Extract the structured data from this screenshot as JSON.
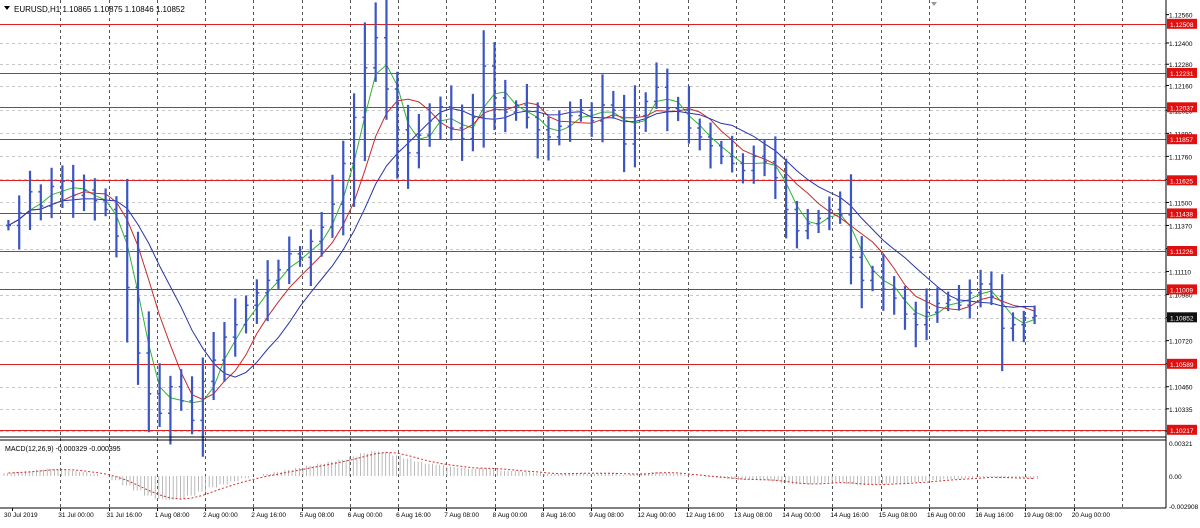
{
  "header": {
    "symbol_line": "EURUSD,H1  1.10865 1.10875 1.10846 1.10852",
    "macd_line": "MACD(12,26,9) -0.000329 -0.000395"
  },
  "colors": {
    "background": "#ffffff",
    "candles": "#3b55c4",
    "level_lines": "#e02020",
    "level_label_bg": "#e01010",
    "current_label_bg": "#111111",
    "ma_fast": "#32b332",
    "ma_mid": "#c62a2a",
    "ma_slow": "#2a33a8",
    "grid": "#000000",
    "macd_hist": "#a8a8a8",
    "macd_signal": "#d03030"
  },
  "chart_data": [
    {
      "type": "candlestick",
      "title": "EURUSD,H1",
      "ylim": [
        1.1021,
        1.1262
      ],
      "grid": true,
      "price_ticks": [
        "1.12560",
        "1.12400",
        "1.12280",
        "1.12160",
        "1.12020",
        "1.11890",
        "1.11760",
        "1.11630",
        "1.11500",
        "1.11370",
        "1.11240",
        "1.11110",
        "1.10980",
        "1.10850",
        "1.10720",
        "1.10590",
        "1.10460",
        "1.10335",
        "1.10210"
      ],
      "tick_values": [
        1.1256,
        1.124,
        1.1228,
        1.1216,
        1.1202,
        1.1189,
        1.1176,
        1.1163,
        1.115,
        1.1137,
        1.1124,
        1.1111,
        1.1098,
        1.1085,
        1.1072,
        1.1059,
        1.1046,
        1.10335,
        1.1021
      ],
      "levels": [
        {
          "label": "1.12508",
          "value": 1.12508
        },
        {
          "label": "1.12231",
          "value": 1.12231
        },
        {
          "label": "1.12037",
          "value": 1.12037
        },
        {
          "label": "1.11857",
          "value": 1.11857
        },
        {
          "label": "1.11625",
          "value": 1.11625
        },
        {
          "label": "1.11438",
          "value": 1.11438
        },
        {
          "label": "1.11226",
          "value": 1.11226
        },
        {
          "label": "1.11009",
          "value": 1.11009
        },
        {
          "label": "1.10589",
          "value": 1.10589
        },
        {
          "label": "1.10217",
          "value": 1.10217
        }
      ],
      "current_price": {
        "label": "1.10852",
        "value": 1.10852
      },
      "x_labels": [
        "30 Jul 2019",
        "31 Jul 00:00",
        "31 Jul 16:00",
        "1 Aug 08:00",
        "2 Aug 00:00",
        "2 Aug 16:00",
        "5 Aug 08:00",
        "6 Aug 00:00",
        "6 Aug 16:00",
        "7 Aug 08:00",
        "8 Aug 00:00",
        "8 Aug 16:00",
        "9 Aug 08:00",
        "12 Aug 00:00",
        "12 Aug 16:00",
        "13 Aug 08:00",
        "14 Aug 00:00",
        "14 Aug 16:00",
        "15 Aug 08:00",
        "16 Aug 00:00",
        "16 Aug 16:00",
        "19 Aug 08:00",
        "20 Aug 00:00"
      ],
      "closes": [
        1.1137,
        1.1144,
        1.1156,
        1.1148,
        1.1159,
        1.1162,
        1.1154,
        1.1157,
        1.1151,
        1.1146,
        1.1131,
        1.1102,
        1.1065,
        1.1042,
        1.1031,
        1.1046,
        1.1038,
        1.1027,
        1.1049,
        1.1061,
        1.1074,
        1.1081,
        1.1092,
        1.1099,
        1.1106,
        1.1112,
        1.1121,
        1.1119,
        1.1128,
        1.1136,
        1.1149,
        1.1172,
        1.1198,
        1.1226,
        1.1243,
        1.1214,
        1.1191,
        1.1178,
        1.1188,
        1.1196,
        1.1204,
        1.1192,
        1.1186,
        1.1198,
        1.1227,
        1.1209,
        1.1201,
        1.1205,
        1.1198,
        1.1191,
        1.1187,
        1.1193,
        1.1199,
        1.1202,
        1.1196,
        1.1205,
        1.1202,
        1.1183,
        1.1199,
        1.1207,
        1.1215,
        1.1203,
        1.1202,
        1.1192,
        1.1187,
        1.1182,
        1.1176,
        1.1172,
        1.1168,
        1.1176,
        1.1173,
        1.1164,
        1.1146,
        1.1134,
        1.1138,
        1.1141,
        1.1146,
        1.1143,
        1.1119,
        1.1106,
        1.1111,
        1.1101,
        1.1096,
        1.1087,
        1.1081,
        1.1088,
        1.1093,
        1.1095,
        1.1092,
        1.1099,
        1.1104,
        1.1097,
        1.1079,
        1.1081,
        1.1085,
        1.1086
      ]
    },
    {
      "type": "macd",
      "title": "MACD(12,26,9)",
      "ylim": [
        -0.002908,
        0.00321
      ],
      "ticks": [
        "0.00321",
        "0.00",
        "-0.002908"
      ],
      "tick_values": [
        0.00321,
        0,
        -0.002908
      ],
      "histogram": [
        0.0003,
        0.0004,
        0.0005,
        0.0006,
        0.0007,
        0.0006,
        0.0005,
        0.0004,
        0.0002,
        0.0,
        -0.0004,
        -0.0009,
        -0.0014,
        -0.0019,
        -0.0022,
        -0.0023,
        -0.0022,
        -0.0019,
        -0.0015,
        -0.0011,
        -0.0008,
        -0.0005,
        -0.0002,
        0.0,
        0.0002,
        0.0004,
        0.0006,
        0.0008,
        0.001,
        0.0012,
        0.0014,
        0.0016,
        0.0019,
        0.0022,
        0.0024,
        0.0023,
        0.002,
        0.0017,
        0.0014,
        0.0012,
        0.0011,
        0.0009,
        0.0008,
        0.0007,
        0.0008,
        0.0007,
        0.0005,
        0.0005,
        0.0004,
        0.0003,
        0.0002,
        0.0002,
        0.0003,
        0.0003,
        0.0002,
        0.0003,
        0.0003,
        0.0001,
        0.0002,
        0.0003,
        0.0004,
        0.0003,
        0.0002,
        0.0001,
        0.0,
        -0.0001,
        -0.0002,
        -0.0003,
        -0.0004,
        -0.0003,
        -0.0004,
        -0.0005,
        -0.0007,
        -0.0008,
        -0.0008,
        -0.0007,
        -0.0006,
        -0.0006,
        -0.0008,
        -0.0009,
        -0.0008,
        -0.0008,
        -0.0007,
        -0.0007,
        -0.0006,
        -0.0005,
        -0.0004,
        -0.0003,
        -0.0003,
        -0.0002,
        -0.0001,
        -0.0001,
        -0.0002,
        -0.0002,
        -0.0002,
        -0.0003
      ]
    }
  ]
}
